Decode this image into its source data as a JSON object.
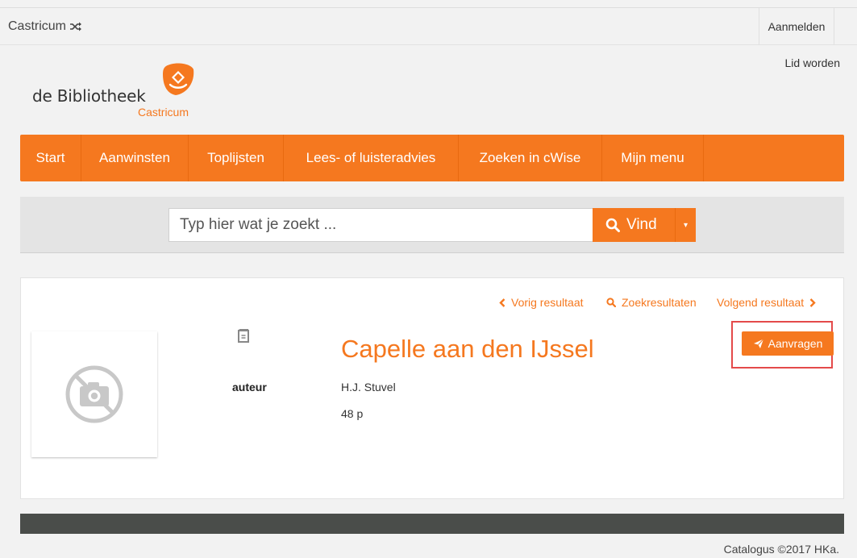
{
  "header": {
    "branch": "Castricum",
    "login": "Aanmelden",
    "join": "Lid worden"
  },
  "logo": {
    "name": "de Bibliotheek",
    "location": "Castricum"
  },
  "nav": {
    "items": [
      {
        "label": "Start"
      },
      {
        "label": "Aanwinsten"
      },
      {
        "label": "Toplijsten"
      },
      {
        "label": "Lees- of luisteradvies"
      },
      {
        "label": "Zoeken in cWise"
      },
      {
        "label": "Mijn menu"
      }
    ]
  },
  "search": {
    "placeholder": "Typ hier wat je zoekt ...",
    "button": "Vind"
  },
  "pager": {
    "previous": "Vorig resultaat",
    "results": "Zoekresultaten",
    "next": "Volgend resultaat"
  },
  "record": {
    "title": "Capelle aan den IJssel",
    "author_label": "auteur",
    "author": "H.J. Stuvel",
    "pages": "48 p",
    "request_button": "Aanvragen"
  },
  "footer": {
    "copyright": "Catalogus ©2017 HKa."
  },
  "colors": {
    "accent": "#f5781f",
    "footer": "#4a4d4a",
    "highlight": "#e44a4a"
  }
}
